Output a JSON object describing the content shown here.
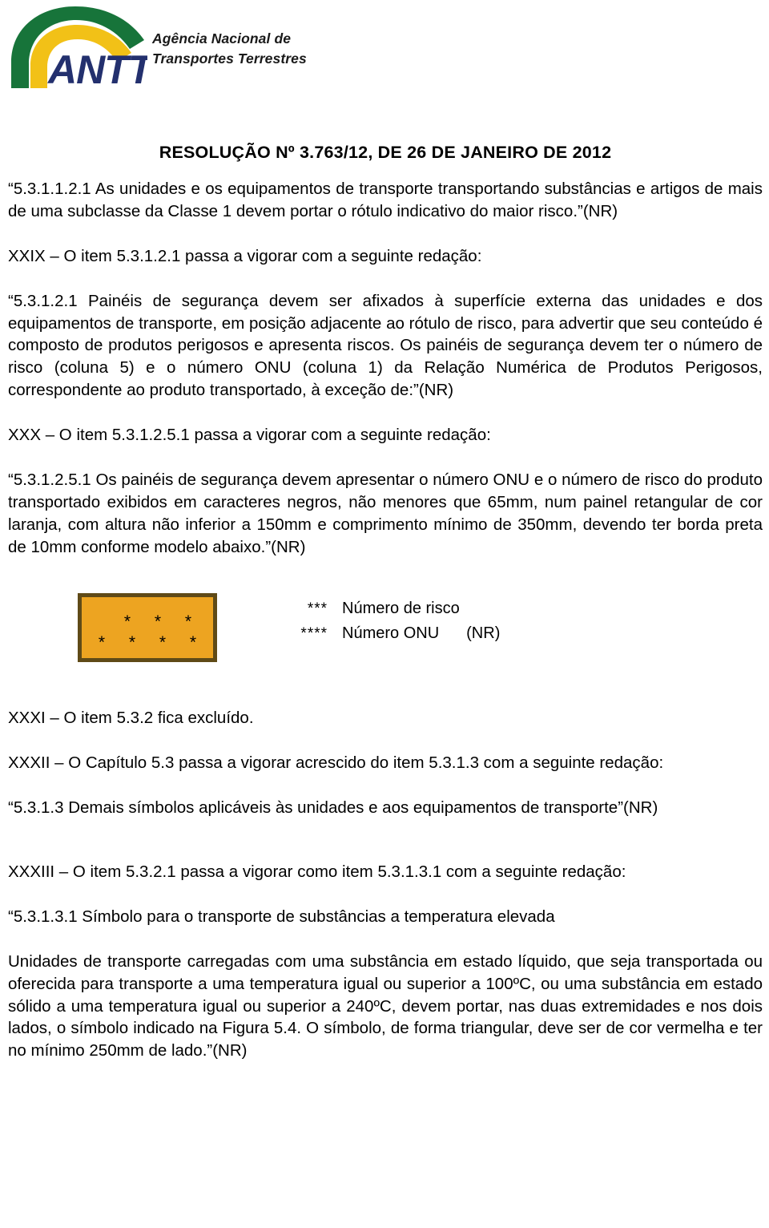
{
  "header": {
    "logo_alt": "ANTT",
    "logo_wordmark": "ANTT",
    "agency_name": "Agência Nacional de\nTransportes Terrestres",
    "colors": {
      "green": "#17743a",
      "yellow": "#f2c117",
      "navy": "#23306e"
    }
  },
  "document": {
    "title": "RESOLUÇÃO Nº 3.763/12, DE 26 DE JANEIRO DE 2012",
    "paragraphs": [
      "“5.3.1.1.2.1 As unidades e os equipamentos de transporte transportando substâncias e artigos de mais de uma subclasse da Classe 1 devem portar o rótulo indicativo do maior risco.”(NR)",
      "XXIX – O item 5.3.1.2.1 passa a vigorar com a seguinte redação:",
      "“5.3.1.2.1 Painéis de segurança devem ser afixados à superfície externa das unidades e dos equipamentos de transporte, em posição adjacente ao rótulo de risco, para advertir que seu conteúdo é composto de produtos perigosos e apresenta riscos. Os painéis de segurança devem ter o número de risco (coluna 5) e o número ONU (coluna 1) da Relação Numérica de Produtos Perigosos, correspondente ao produto transportado,  à exceção de:”(NR)",
      "XXX – O item 5.3.1.2.5.1 passa a vigorar com a seguinte redação:",
      "“5.3.1.2.5.1 Os painéis de segurança devem apresentar o número ONU e o número de risco do produto transportado exibidos em caracteres negros, não menores que 65mm, num painel retangular de cor laranja, com altura não inferior a 150mm e comprimento mínimo de 350mm, devendo ter borda preta de 10mm conforme modelo abaixo.”(NR)",
      "XXXI – O item 5.3.2 fica excluído.",
      "XXXII – O Capítulo 5.3 passa a vigorar acrescido do item 5.3.1.3 com a seguinte redação:",
      "“5.3.1.3 Demais símbolos aplicáveis às unidades e aos equipamentos de transporte”(NR)",
      "XXXIII – O item 5.3.2.1 passa a vigorar como item 5.3.1.3.1 com a seguinte redação:",
      "“5.3.1.3.1 Símbolo para o transporte de substâncias a temperatura elevada",
      "Unidades de transporte carregadas com uma substância em estado líquido, que seja transportada ou oferecida para transporte a uma temperatura igual ou superior a 100ºC, ou uma substância em estado sólido a uma temperatura igual ou superior a 240ºC, devem portar, nas duas extremidades e nos dois lados, o símbolo indicado na Figura 5.4. O símbolo, de forma triangular, deve ser de cor vermelha e ter no mínimo 250mm de lado.”(NR)"
    ],
    "figure": {
      "placard": {
        "stars_top": "* * *",
        "stars_bottom": "* * * *",
        "fill_color": "#eda421",
        "border_color": "#5f4a17"
      },
      "legend": [
        {
          "stars": "***",
          "text": "Número de risco",
          "nr": ""
        },
        {
          "stars": "****",
          "text": "Número ONU",
          "nr": "(NR)"
        }
      ]
    }
  }
}
